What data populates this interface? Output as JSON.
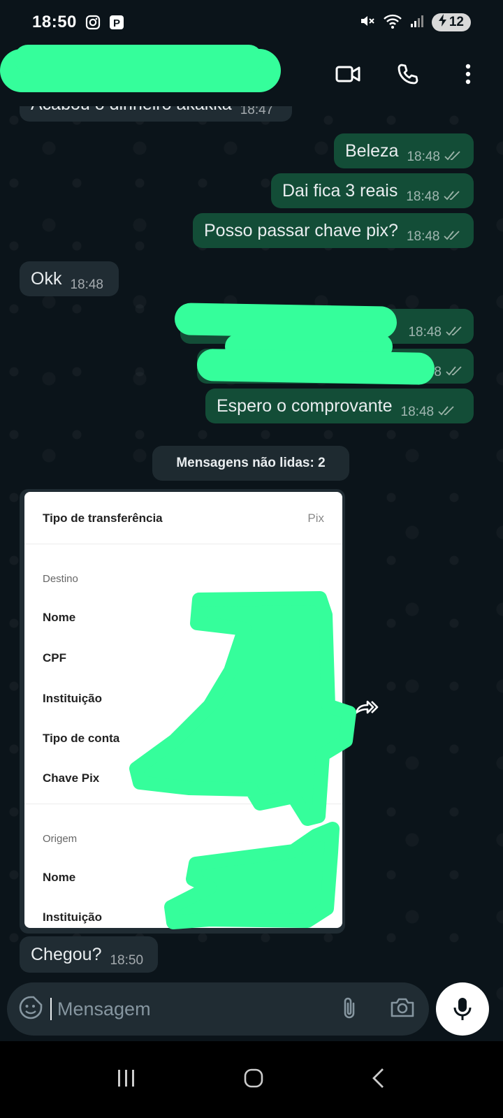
{
  "status_bar": {
    "time": "18:50",
    "battery": "12"
  },
  "header": {
    "contact_name_redacted": true
  },
  "messages": [
    {
      "direction": "in",
      "text": "Acabou o dinheiro akakka",
      "time": "18:47"
    },
    {
      "direction": "out",
      "text": "Beleza",
      "time": "18:48"
    },
    {
      "direction": "out",
      "text": "Dai fica 3 reais",
      "time": "18:48"
    },
    {
      "direction": "out",
      "text": "Posso passar chave pix?",
      "time": "18:48"
    },
    {
      "direction": "in",
      "text": "Okk",
      "time": "18:48"
    },
    {
      "direction": "out",
      "text": "",
      "time": "18:48"
    },
    {
      "direction": "out",
      "text": "",
      "time": "18:48"
    },
    {
      "direction": "out",
      "text": "Espero o comprovante",
      "time": "18:48"
    },
    {
      "direction": "in",
      "text": "Chegou?",
      "time": "18:50"
    }
  ],
  "unread_banner": "Mensagens não lidas: 2",
  "receipt": {
    "transfer_type_label": "Tipo de transferência",
    "transfer_type_value": "Pix",
    "destination_section": "Destino",
    "dest_name": "Nome",
    "dest_cpf": "CPF",
    "dest_institution": "Instituição",
    "dest_account_type": "Tipo de conta",
    "dest_pix_key": "Chave Pix",
    "origin_section": "Origem",
    "origin_name": "Nome",
    "origin_institution": "Instituição"
  },
  "input": {
    "placeholder": "Mensagem"
  },
  "colors": {
    "background": "#0b141a",
    "incoming_bubble": "#202c33",
    "outgoing_bubble": "#134d37",
    "redaction": "#35fe9b"
  }
}
